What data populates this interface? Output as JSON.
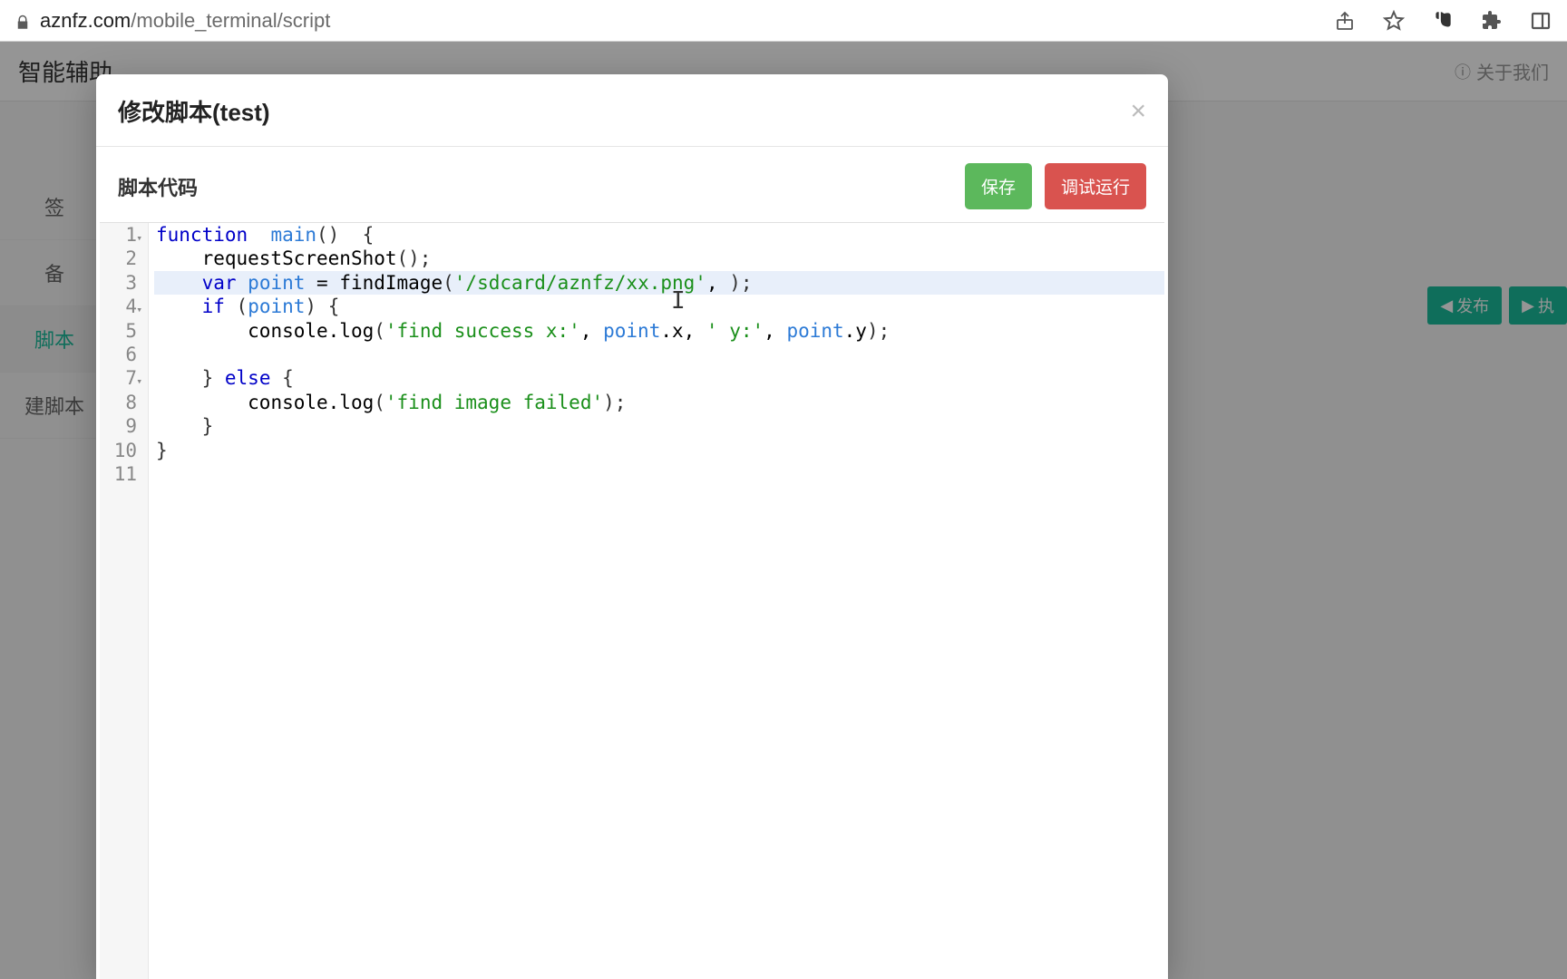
{
  "browser": {
    "url_domain": "aznfz.com",
    "url_path": "/mobile_terminal/script",
    "icons": {
      "share": "share-icon",
      "star": "star-icon",
      "evernote": "evernote-icon",
      "puzzle": "extensions-icon",
      "panel": "panel-icon"
    }
  },
  "background": {
    "site_title": "智能辅助",
    "about": "关于我们",
    "sidebar": [
      "签",
      "备",
      "脚本",
      "建脚本"
    ],
    "right_buttons": [
      "发布",
      "执"
    ]
  },
  "modal": {
    "title": "修改脚本(test)",
    "close": "×",
    "toolbar_label": "脚本代码",
    "save_label": "保存",
    "run_label": "调试运行"
  },
  "code": {
    "lines": [
      {
        "n": 1,
        "fold": true,
        "tokens": [
          [
            "kw",
            "function"
          ],
          [
            "",
            "  "
          ],
          [
            "name",
            "main"
          ],
          [
            "par",
            "()"
          ],
          [
            "",
            "  "
          ],
          [
            "par",
            "{"
          ]
        ]
      },
      {
        "n": 2,
        "fold": false,
        "tokens": [
          [
            "",
            "    "
          ],
          [
            "",
            "requestScreenShot"
          ],
          [
            "par",
            "();"
          ]
        ]
      },
      {
        "n": 3,
        "fold": false,
        "active": true,
        "tokens": [
          [
            "",
            "    "
          ],
          [
            "kw",
            "var"
          ],
          [
            "",
            " "
          ],
          [
            "name",
            "point"
          ],
          [
            "",
            " = "
          ],
          [
            "",
            "findImage"
          ],
          [
            "par",
            "("
          ],
          [
            "str",
            "'/sdcard/aznfz/xx.png'"
          ],
          [
            "",
            ", "
          ],
          [
            "par",
            ");"
          ]
        ]
      },
      {
        "n": 4,
        "fold": true,
        "tokens": [
          [
            "",
            "    "
          ],
          [
            "kw",
            "if"
          ],
          [
            "",
            " "
          ],
          [
            "par",
            "("
          ],
          [
            "name",
            "point"
          ],
          [
            "par",
            ")"
          ],
          [
            "",
            " "
          ],
          [
            "par",
            "{"
          ]
        ]
      },
      {
        "n": 5,
        "fold": false,
        "tokens": [
          [
            "",
            "        "
          ],
          [
            "",
            "console.log"
          ],
          [
            "par",
            "("
          ],
          [
            "str",
            "'find success x:'"
          ],
          [
            "",
            ", "
          ],
          [
            "name",
            "point"
          ],
          [
            "",
            ".x, "
          ],
          [
            "str",
            "' y:'"
          ],
          [
            "",
            ", "
          ],
          [
            "name",
            "point"
          ],
          [
            "",
            ".y"
          ],
          [
            "par",
            ");"
          ]
        ]
      },
      {
        "n": 6,
        "fold": false,
        "tokens": [
          [
            "",
            ""
          ]
        ]
      },
      {
        "n": 7,
        "fold": true,
        "tokens": [
          [
            "",
            "    "
          ],
          [
            "par",
            "}"
          ],
          [
            "",
            " "
          ],
          [
            "kw",
            "else"
          ],
          [
            "",
            " "
          ],
          [
            "par",
            "{"
          ]
        ]
      },
      {
        "n": 8,
        "fold": false,
        "tokens": [
          [
            "",
            "        "
          ],
          [
            "",
            "console.log"
          ],
          [
            "par",
            "("
          ],
          [
            "str",
            "'find image failed'"
          ],
          [
            "par",
            ");"
          ]
        ]
      },
      {
        "n": 9,
        "fold": false,
        "tokens": [
          [
            "",
            "    "
          ],
          [
            "par",
            "}"
          ]
        ]
      },
      {
        "n": 10,
        "fold": false,
        "tokens": [
          [
            "par",
            "}"
          ]
        ]
      },
      {
        "n": 11,
        "fold": false,
        "tokens": [
          [
            "",
            ""
          ]
        ]
      }
    ]
  }
}
